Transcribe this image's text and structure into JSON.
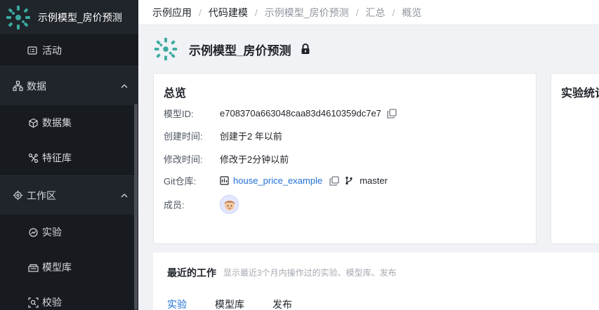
{
  "sidebar": {
    "app_name": "示例模型_房价预测",
    "items": [
      {
        "label": "活动",
        "icon": "activity-icon"
      },
      {
        "label": "数据",
        "icon": "data-icon",
        "group": true
      },
      {
        "label": "数据集",
        "icon": "dataset-icon"
      },
      {
        "label": "特征库",
        "icon": "feature-store-icon"
      },
      {
        "label": "工作区",
        "icon": "workspace-icon",
        "group": true
      },
      {
        "label": "实验",
        "icon": "experiment-icon"
      },
      {
        "label": "模型库",
        "icon": "model-library-icon"
      },
      {
        "label": "校验",
        "icon": "validation-icon"
      }
    ]
  },
  "breadcrumb": {
    "items": [
      "示例应用",
      "代码建模",
      "示例模型_房价预测",
      "汇总",
      "概览"
    ],
    "separator": "/"
  },
  "page": {
    "title": "示例模型_房价预测"
  },
  "overview": {
    "title": "总览",
    "model_id_label": "模型ID:",
    "model_id": "e708370a663048caa83d4610359dc7e7",
    "created_label": "创建时间:",
    "created": "创建于2 年以前",
    "modified_label": "修改时间:",
    "modified": "修改于2分钟以前",
    "git_label": "Git仓库:",
    "git_repo": "house_price_example",
    "git_branch": "master",
    "members_label": "成员:"
  },
  "stats": {
    "title": "实验统计"
  },
  "recent": {
    "title": "最近的工作",
    "description": "显示最近3个月内操作过的实验、模型库、发布",
    "tabs": [
      "实验",
      "模型库",
      "发布"
    ],
    "active_tab": "实验"
  },
  "colors": {
    "sidebar_bg": "#20242b",
    "accent": "#1f6fd6",
    "logo": "#3aa99f"
  }
}
